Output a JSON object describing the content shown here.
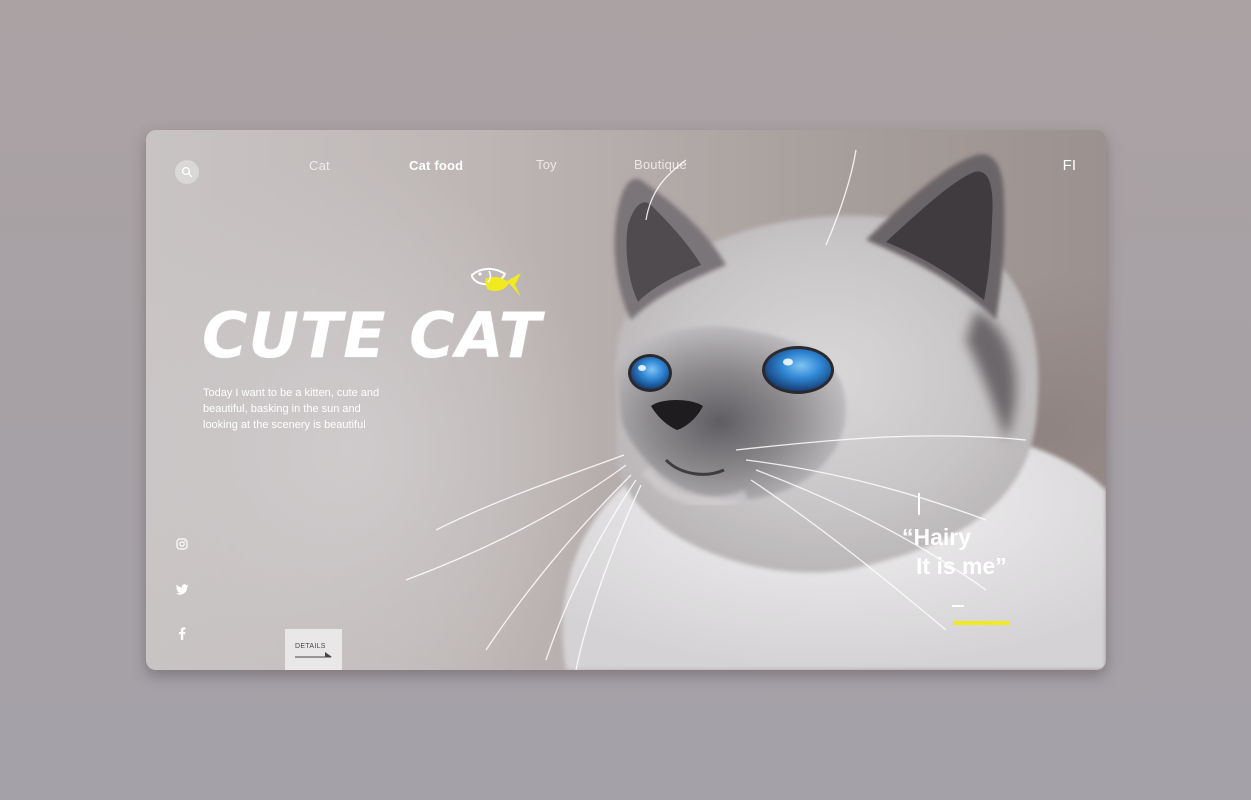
{
  "nav": {
    "items": [
      {
        "label": "Cat",
        "active": false
      },
      {
        "label": "Cat food",
        "active": true
      },
      {
        "label": "Toy",
        "active": false
      },
      {
        "label": "Boutique",
        "active": false
      }
    ],
    "language": "FI"
  },
  "hero": {
    "title": "CUTE CAT",
    "description": "Today I want to be a kitten, cute and beautiful, basking in the sun and looking at the scenery is beautiful"
  },
  "details_button": {
    "label": "DETAILS"
  },
  "quote": {
    "line1": "“Hairy",
    "line2": "It is me”"
  },
  "icons": {
    "search": "search-icon",
    "fish": "fish-icon",
    "instagram": "instagram-icon",
    "twitter": "twitter-icon",
    "facebook": "facebook-icon"
  },
  "colors": {
    "accent": "#f0ea1e",
    "text": "#ffffff",
    "page_bg": "#a9a3a6"
  }
}
